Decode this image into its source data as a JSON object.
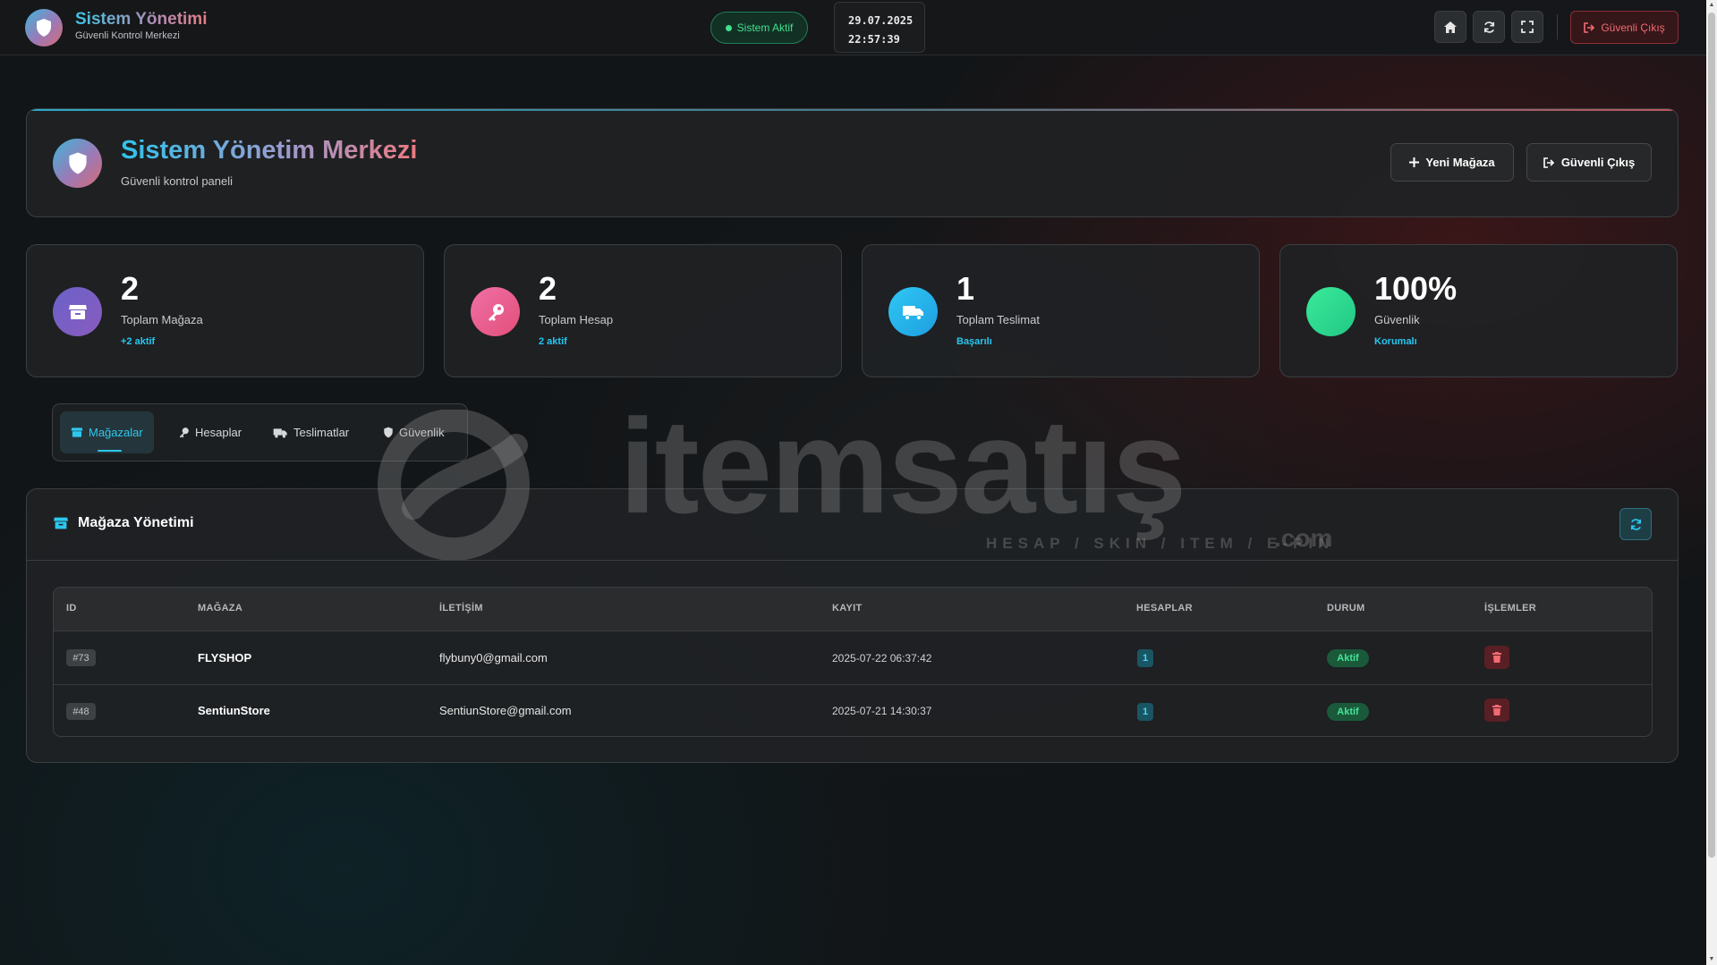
{
  "topnav": {
    "brand_title": "Sistem Yönetimi",
    "brand_subtitle": "Güvenli Kontrol Merkezi",
    "status_label": "Sistem Aktif",
    "date": "29.07.2025",
    "time": "22:57:39",
    "logout_label": "Güvenli Çıkış"
  },
  "header": {
    "title": "Sistem Yönetim Merkezi",
    "subtitle": "Güvenli kontrol paneli",
    "new_store_label": "Yeni Mağaza",
    "logout_label": "Güvenli Çıkış"
  },
  "stats": [
    {
      "value": "2",
      "label": "Toplam Mağaza",
      "note": "+2 aktif",
      "icon": "store-icon",
      "color": "#7a63c8"
    },
    {
      "value": "2",
      "label": "Toplam Hesap",
      "note": "2 aktif",
      "icon": "key-icon",
      "color": "#e9578f"
    },
    {
      "value": "1",
      "label": "Toplam Teslimat",
      "note": "Başarılı",
      "icon": "truck-icon",
      "color": "#29b7ef"
    },
    {
      "value": "100%",
      "label": "Güvenlik",
      "note": "Korumalı",
      "icon": "shield-check-icon",
      "color": "#33e08f"
    }
  ],
  "tabs": [
    {
      "label": "Mağazalar",
      "active": true,
      "icon": "store-icon"
    },
    {
      "label": "Hesaplar",
      "active": false,
      "icon": "key-icon"
    },
    {
      "label": "Teslimatlar",
      "active": false,
      "icon": "truck-icon"
    },
    {
      "label": "Güvenlik",
      "active": false,
      "icon": "shield-icon"
    }
  ],
  "store_table": {
    "title": "Mağaza Yönetimi",
    "columns": [
      "ID",
      "MAĞAZA",
      "İLETİŞİM",
      "KAYIT",
      "HESAPLAR",
      "DURUM",
      "İŞLEMLER"
    ],
    "rows": [
      {
        "id": "#73",
        "name": "FLYSHOP",
        "contact": "flybuny0@gmail.com",
        "registered": "2025-07-22 06:37:42",
        "accounts": "1",
        "status": "Aktif"
      },
      {
        "id": "#48",
        "name": "SentiunStore",
        "contact": "SentiunStore@gmail.com",
        "registered": "2025-07-21 14:30:37",
        "accounts": "1",
        "status": "Aktif"
      }
    ]
  },
  "watermark": {
    "word": "itemsatış",
    "tagline": "HESAP / SKIN / ITEM / E-PIN",
    "suffix": ".com"
  },
  "colors": {
    "accent": "#2ec7ee",
    "danger": "#f06b72",
    "success": "#3fe08f"
  }
}
